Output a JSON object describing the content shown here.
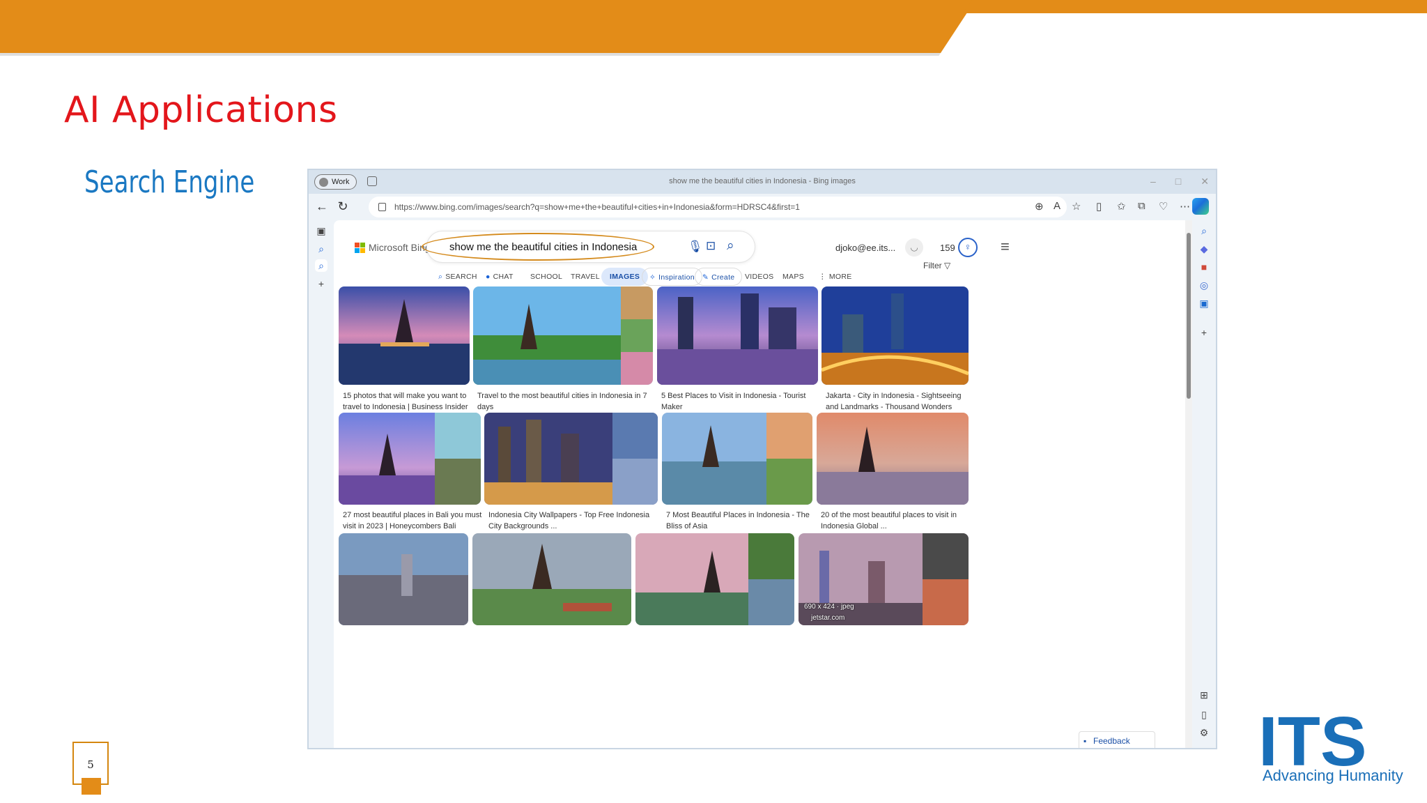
{
  "slide": {
    "title": "AI Applications",
    "subtitle": "Search Engine",
    "page_number": "5",
    "logo_text": "ITS",
    "logo_tagline": "Advancing Humanity"
  },
  "browser": {
    "profile": "Work",
    "window_title": "show me the beautiful cities in Indonesia - Bing images",
    "url": "https://www.bing.com/images/search?q=show+me+the+beautiful+cities+in+Indonesia&form=HDRSC4&first=1"
  },
  "bing": {
    "logo": "Microsoft Bing",
    "query": "show me the beautiful cities in Indonesia",
    "account": "djoko@ee.its...",
    "points": "159",
    "tabs": [
      "SEARCH",
      "CHAT",
      "SCHOOL",
      "TRAVEL",
      "IMAGES",
      "Inspiration",
      "Create",
      "VIDEOS",
      "MAPS",
      "MORE"
    ],
    "filter": "Filter",
    "feedback": "Feedback",
    "hover_meta": "690 x 424 · jpeg",
    "hover_source": "jetstar.com"
  },
  "results": [
    {
      "caption": "15 photos that will make you want to travel to Indonesia | Business Insider"
    },
    {
      "caption": "Travel to the most beautiful cities in Indonesia in 7 days"
    },
    {
      "caption": "5 Best Places to Visit in Indonesia - Tourist Maker"
    },
    {
      "caption": "Jakarta - City in Indonesia - Sightseeing and Landmarks - Thousand Wonders"
    },
    {
      "caption": "27 most beautiful places in Bali you must visit in 2023 | Honeycombers Bali"
    },
    {
      "caption": "Indonesia City Wallpapers - Top Free Indonesia City Backgrounds ..."
    },
    {
      "caption": "7 Most Beautiful Places in Indonesia - The Bliss of Asia"
    },
    {
      "caption": "20 of the most beautiful places to visit in Indonesia Global ..."
    }
  ],
  "colors": {
    "banner": "#e38c18",
    "title": "#e3161b",
    "subtitle": "#1a78c2",
    "bing_accent": "#1a4fa6",
    "annotation": "#d48a1c"
  }
}
